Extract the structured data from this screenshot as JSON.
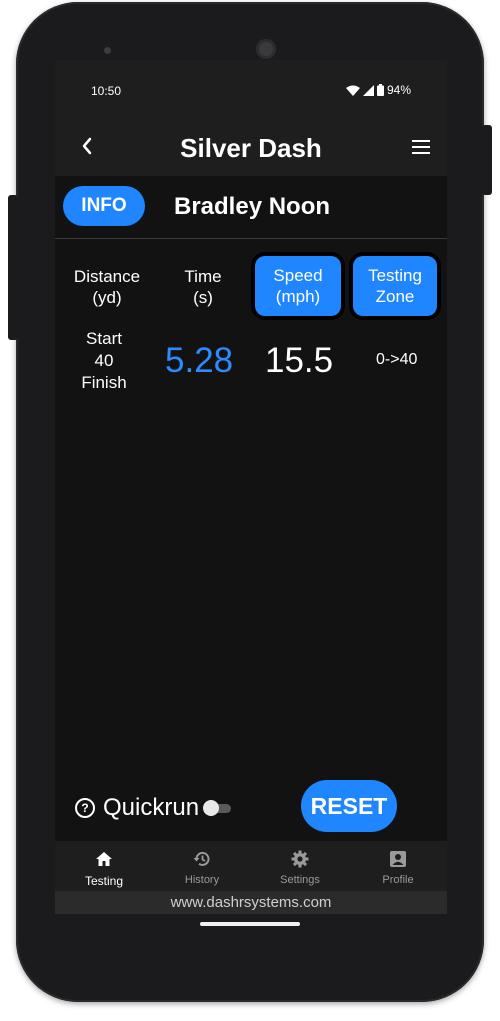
{
  "status_bar": {
    "time": "10:50",
    "battery": "94%"
  },
  "app_bar": {
    "title": "Silver Dash"
  },
  "athlete": {
    "info_label": "INFO",
    "name": "Bradley Noon"
  },
  "table": {
    "headers": {
      "distance": [
        "Distance",
        "(yd)"
      ],
      "time": [
        "Time",
        "(s)"
      ],
      "speed": [
        "Speed",
        "(mph)"
      ],
      "zone": [
        "Testing",
        "Zone"
      ]
    },
    "row": {
      "distance": [
        "Start",
        "40",
        "Finish"
      ],
      "time": "5.28",
      "speed": "15.5",
      "zone": "0->40"
    }
  },
  "controls": {
    "quickrun_label": "Quickrun",
    "quickrun_on": false,
    "reset_label": "RESET"
  },
  "nav": [
    {
      "label": "Testing",
      "icon": "home-icon",
      "active": true
    },
    {
      "label": "History",
      "icon": "history-icon",
      "active": false
    },
    {
      "label": "Settings",
      "icon": "gear-icon",
      "active": false
    },
    {
      "label": "Profile",
      "icon": "profile-icon",
      "active": false
    }
  ],
  "footer": {
    "url": "www.dashrsystems.com"
  },
  "colors": {
    "accent": "#1f86ff",
    "time_value": "#2b8cff",
    "background": "#121212",
    "bar": "#1e1e1e"
  }
}
